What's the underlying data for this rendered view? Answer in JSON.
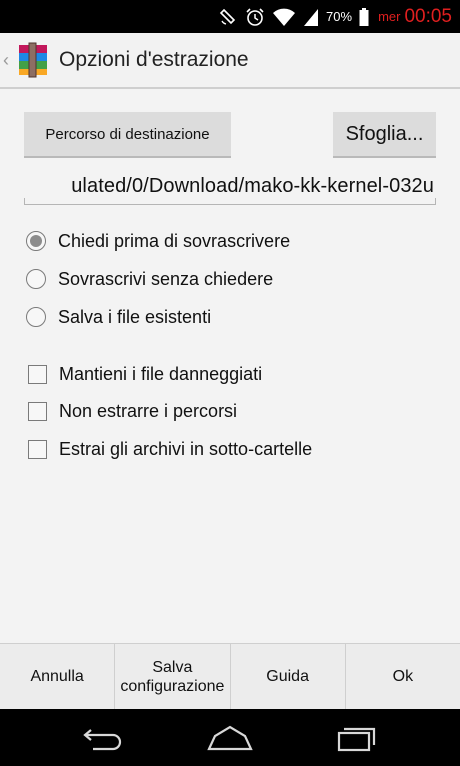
{
  "status_bar": {
    "battery_percent": "70%",
    "day": "mer",
    "time": "00:05",
    "icons": [
      "rotation-lock-icon",
      "alarm-icon",
      "wifi-icon",
      "signal-icon",
      "battery-icon"
    ],
    "accent_color": "#e01f1f"
  },
  "action_bar": {
    "title": "Opzioni d'estrazione",
    "logo": "winrar-archive-icon"
  },
  "destination": {
    "dest_button_label": "Percorso di destinazione",
    "browse_button_label": "Sfoglia...",
    "path_value": "ulated/0/Download/mako-kk-kernel-032u"
  },
  "overwrite_options": [
    {
      "label": "Chiedi prima di sovrascrivere",
      "selected": true
    },
    {
      "label": "Sovrascrivi senza chiedere",
      "selected": false
    },
    {
      "label": "Salva i file esistenti",
      "selected": false
    }
  ],
  "checkbox_options": [
    {
      "label": "Mantieni i file danneggiati",
      "checked": false
    },
    {
      "label": "Non estrarre i percorsi",
      "checked": false
    },
    {
      "label": "Estrai gli archivi in sotto-cartelle",
      "checked": false
    }
  ],
  "bottom_bar": {
    "cancel": "Annulla",
    "save_config_line1": "Salva",
    "save_config_line2": "configurazione",
    "help": "Guida",
    "ok": "Ok"
  },
  "nav_bar": {
    "icons": [
      "back-icon",
      "home-icon",
      "recent-apps-icon"
    ]
  }
}
